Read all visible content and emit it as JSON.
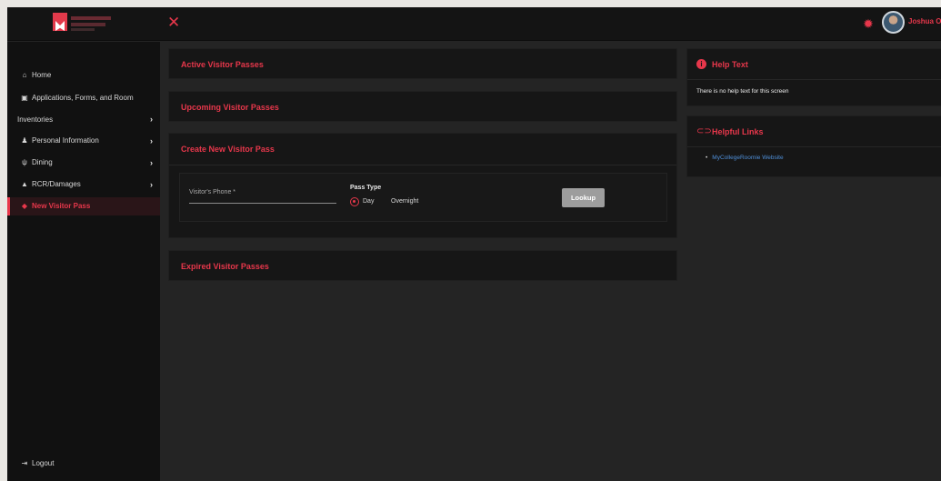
{
  "header": {
    "theme_icon": "sun-icon",
    "user_name": "Joshua Or"
  },
  "sidebar": {
    "items": [
      {
        "label": "Home",
        "icon": "home-icon"
      },
      {
        "label": "Applications, Forms, and Room",
        "icon": "clipboard-icon"
      },
      {
        "label": "Inventories"
      },
      {
        "label": "Personal Information",
        "icon": "person-icon"
      },
      {
        "label": "Dining",
        "icon": "utensils-icon"
      },
      {
        "label": "RCR/Damages",
        "icon": "warning-icon"
      },
      {
        "label": "New Visitor Pass",
        "icon": "ticket-icon"
      }
    ],
    "logout_label": "Logout"
  },
  "sections": {
    "active": "Active Visitor Passes",
    "upcoming": "Upcoming Visitor Passes",
    "create": "Create New Visitor Pass",
    "expired": "Expired Visitor Passes"
  },
  "form": {
    "phone_label": "Visitor's Phone *",
    "pass_type_label": "Pass Type",
    "option_day": "Day",
    "option_overnight": "Overnight",
    "selected_option": "Day",
    "lookup_label": "Lookup"
  },
  "help": {
    "title": "Help Text",
    "body": "There is no help text for this screen"
  },
  "links": {
    "title": "Helpful Links",
    "items": [
      "MyCollegeRoomie Website"
    ]
  },
  "colors": {
    "accent": "#e7374b",
    "link": "#4f8fd8",
    "background": "#242424"
  }
}
